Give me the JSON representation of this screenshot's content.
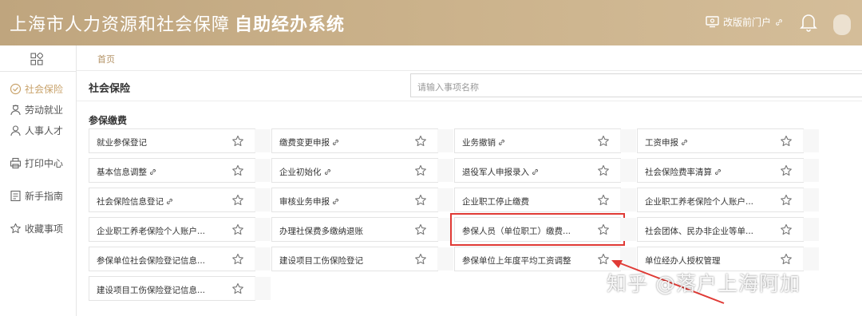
{
  "header": {
    "title_main": "上海市人力资源和社会保障",
    "title_bold": "自助经办系统",
    "portal_label": "改版前门户",
    "icons": [
      "monitor-icon",
      "link-icon",
      "bell-icon",
      "avatar"
    ]
  },
  "sidebar": {
    "items": [
      {
        "label": "社会保险",
        "icon": "shield-icon",
        "active": true
      },
      {
        "label": "劳动就业",
        "icon": "worker-icon",
        "active": false
      },
      {
        "label": "人事人才",
        "icon": "person-icon",
        "active": false
      },
      {
        "label": "打印中心",
        "icon": "printer-icon",
        "active": false
      },
      {
        "label": "新手指南",
        "icon": "guide-icon",
        "active": false
      },
      {
        "label": "收藏事项",
        "icon": "star-icon",
        "active": false
      }
    ]
  },
  "breadcrumb": "首页",
  "main": {
    "section_title": "社会保险",
    "search_placeholder": "请输入事项名称",
    "group_title": "参保缴费",
    "cards": [
      {
        "label": "就业参保登记",
        "link": false
      },
      {
        "label": "缴费变更申报",
        "link": true
      },
      {
        "label": "业务撤销",
        "link": true
      },
      {
        "label": "工资申报",
        "link": true
      },
      {
        "label": "基本信息调整",
        "link": true
      },
      {
        "label": "企业初始化",
        "link": true
      },
      {
        "label": "退役军人申报录入",
        "link": true
      },
      {
        "label": "社会保险费率清算",
        "link": true
      },
      {
        "label": "社会保险信息登记",
        "link": true
      },
      {
        "label": "审核业务申报",
        "link": true
      },
      {
        "label": "企业职工停止缴费",
        "link": false
      },
      {
        "label": "企业职工养老保险个人账户...",
        "link": false
      },
      {
        "label": "企业职工养老保险个人账户...",
        "link": false
      },
      {
        "label": "办理社保费多缴纳退账",
        "link": false
      },
      {
        "label": "参保人员（单位职工）缴费...",
        "link": false,
        "highlighted": true
      },
      {
        "label": "社会团体、民办非企业等单...",
        "link": false
      },
      {
        "label": "参保单位社会保险登记信息...",
        "link": false
      },
      {
        "label": "建设项目工伤保险登记",
        "link": false
      },
      {
        "label": "参保单位上年度平均工资调整",
        "link": false
      },
      {
        "label": "单位经办人授权管理",
        "link": false
      },
      {
        "label": "建设项目工伤保险登记信息...",
        "link": false
      }
    ]
  },
  "watermark": "知乎 @落户上海阿加",
  "colors": {
    "header": "#c8ae85",
    "accent": "#c8a26a",
    "highlight": "#e03a35"
  }
}
